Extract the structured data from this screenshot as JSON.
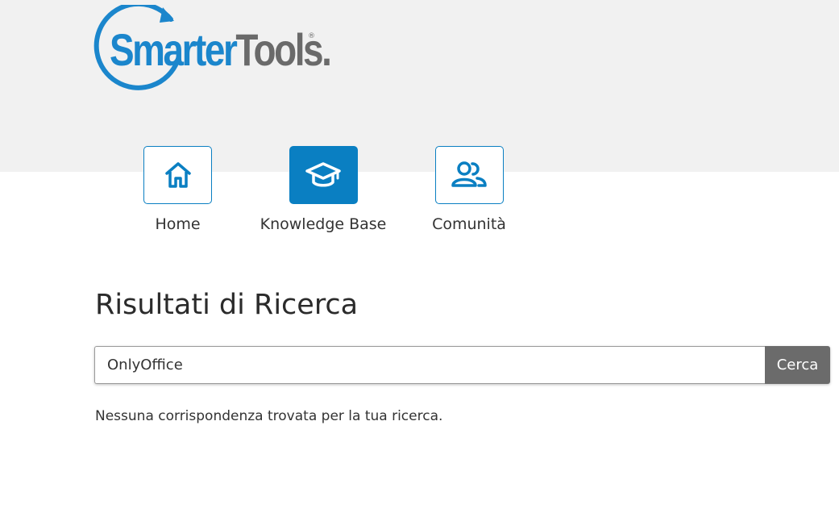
{
  "brand": {
    "name_part1": "Smarter",
    "name_part2": "Tools",
    "name_suffix": ".",
    "registered_mark": "®",
    "colors": {
      "blue": "#1b86cc",
      "gray": "#6a6a6a"
    }
  },
  "nav": {
    "items": [
      {
        "label": "Home",
        "icon": "home-icon",
        "active": false
      },
      {
        "label": "Knowledge Base",
        "icon": "graduation-cap-icon",
        "active": true
      },
      {
        "label": "Comunità",
        "icon": "users-icon",
        "active": false
      }
    ]
  },
  "page": {
    "title": "Risultati di Ricerca"
  },
  "search": {
    "value": "OnlyOffice",
    "button_label": "Cerca"
  },
  "results": {
    "message": "Nessuna corrispondenza trovata per la tua ricerca."
  },
  "colors": {
    "accent": "#0a7fc2",
    "header_band": "#f1f1f1",
    "button": "#6b6b6b"
  }
}
